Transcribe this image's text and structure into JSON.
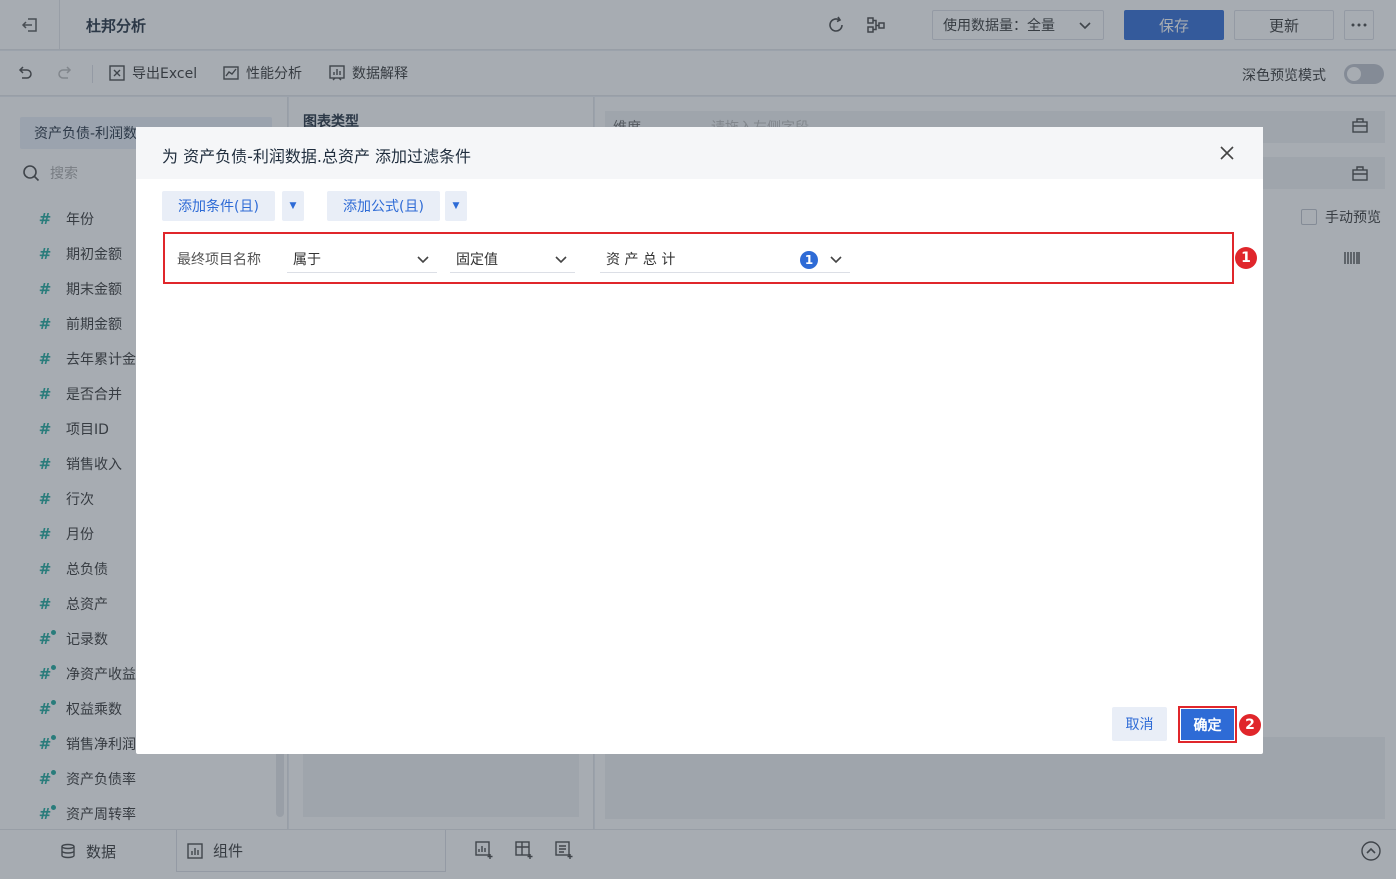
{
  "header": {
    "title": "杜邦分析",
    "data_volume": "使用数据量：全量",
    "save_label": "保存",
    "update_label": "更新"
  },
  "toolbar": {
    "export_excel": "导出Excel",
    "performance": "性能分析",
    "data_explain": "数据解释",
    "dark_preview": "深色预览模式",
    "dark_preview_on": false
  },
  "left_panel": {
    "dataset": "资产负债-利润数",
    "search_placeholder": "搜索",
    "fields": [
      {
        "label": "年份",
        "kind": "number"
      },
      {
        "label": "期初金额",
        "kind": "number"
      },
      {
        "label": "期末金额",
        "kind": "number"
      },
      {
        "label": "前期金额",
        "kind": "number"
      },
      {
        "label": "去年累计金",
        "kind": "number"
      },
      {
        "label": "是否合并",
        "kind": "number"
      },
      {
        "label": "项目ID",
        "kind": "number"
      },
      {
        "label": "销售收入",
        "kind": "number"
      },
      {
        "label": "行次",
        "kind": "number"
      },
      {
        "label": "月份",
        "kind": "number"
      },
      {
        "label": "总负债",
        "kind": "number"
      },
      {
        "label": "总资产",
        "kind": "number"
      },
      {
        "label": "记录数",
        "kind": "count"
      },
      {
        "label": "净资产收益",
        "kind": "calc"
      },
      {
        "label": "权益乘数",
        "kind": "calc"
      },
      {
        "label": "销售净利润",
        "kind": "calc"
      },
      {
        "label": "资产负债率",
        "kind": "calc"
      },
      {
        "label": "资产周转率",
        "kind": "calc"
      }
    ]
  },
  "middle_panel": {
    "chart_type_title": "图表类型"
  },
  "right_panel": {
    "dimension_label": "维度",
    "dimension_placeholder": "请拖入左侧字段",
    "manual_preview": "手动预览"
  },
  "bottom_bar": {
    "tab_data": "数据",
    "tab_component": "组件"
  },
  "dialog": {
    "title": "为 资产负债-利润数据.总资产 添加过滤条件",
    "add_condition": "添加条件(且)",
    "add_formula": "添加公式(且)",
    "condition": {
      "field": "最终项目名称",
      "operator": "属于",
      "value_type": "固定值",
      "value": "资 产 总 计",
      "selected_count": "1"
    },
    "cancel_label": "取消",
    "ok_label": "确定",
    "callout_1": "1",
    "callout_2": "2"
  },
  "colors": {
    "primary": "#2e6bd6",
    "callout": "#e0262b",
    "field_icon": "#1aa89b"
  }
}
